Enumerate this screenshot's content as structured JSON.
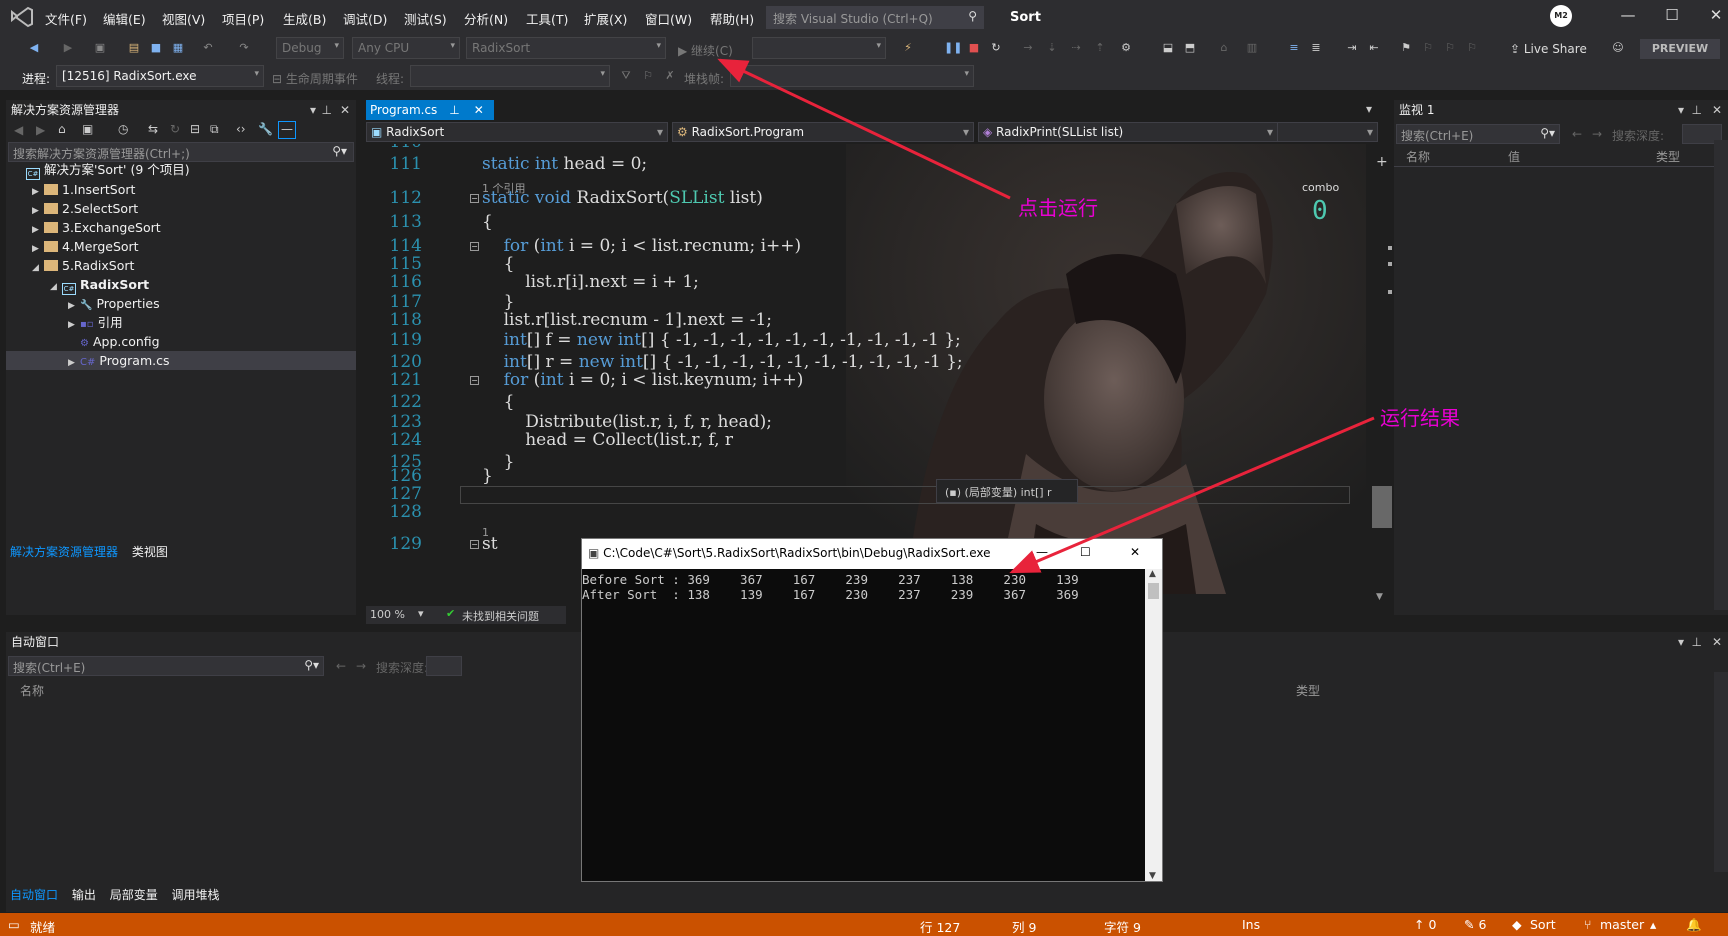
{
  "menu": {
    "items": [
      "文件(F)",
      "编辑(E)",
      "视图(V)",
      "项目(P)",
      "生成(B)",
      "调试(D)",
      "测试(S)",
      "分析(N)",
      "工具(T)",
      "扩展(X)",
      "窗口(W)",
      "帮助(H)"
    ],
    "search_placeholder": "搜索 Visual Studio (Ctrl+Q)",
    "solution_name": "Sort",
    "user_initials": "M2"
  },
  "toolbar": {
    "config": "Debug",
    "platform": "Any CPU",
    "startup_project": "RadixSort",
    "continue_label": "继续(C)",
    "live_share": "Live Share",
    "preview": "PREVIEW",
    "process_label": "进程:",
    "process_value": "[12516] RadixSort.exe",
    "lifecycle_label": "生命周期事件",
    "thread_label": "线程:",
    "stack_label": "堆栈帧:"
  },
  "solution_explorer": {
    "title": "解决方案资源管理器",
    "search_placeholder": "搜索解决方案资源管理器(Ctrl+;)",
    "items": [
      {
        "label": "解决方案'Sort' (9 个项目)",
        "indent": 0,
        "kind": "solution",
        "expand": ""
      },
      {
        "label": "1.InsertSort",
        "indent": 1,
        "kind": "folder",
        "expand": "▶"
      },
      {
        "label": "2.SelectSort",
        "indent": 1,
        "kind": "folder",
        "expand": "▶"
      },
      {
        "label": "3.ExchangeSort",
        "indent": 1,
        "kind": "folder",
        "expand": "▶"
      },
      {
        "label": "4.MergeSort",
        "indent": 1,
        "kind": "folder",
        "expand": "▶"
      },
      {
        "label": "5.RadixSort",
        "indent": 1,
        "kind": "folder",
        "expand": "◢"
      },
      {
        "label": "RadixSort",
        "indent": 2,
        "kind": "project",
        "expand": "◢"
      },
      {
        "label": "Properties",
        "indent": 3,
        "kind": "props",
        "expand": "▶"
      },
      {
        "label": "引用",
        "indent": 3,
        "kind": "refs",
        "expand": "▶"
      },
      {
        "label": "App.config",
        "indent": 3,
        "kind": "config",
        "expand": ""
      },
      {
        "label": "Program.cs",
        "indent": 3,
        "kind": "cs",
        "expand": "▶"
      }
    ],
    "tab_active": "解决方案资源管理器",
    "tab_other": "类视图"
  },
  "editor": {
    "tab_label": "Program.cs",
    "nav_project": "RadixSort",
    "nav_class": "RadixSort.Program",
    "nav_member": "RadixPrint(SLList list)",
    "zoom": "100 %",
    "issues": "未找到相关问题",
    "lines": [
      {
        "n": "110",
        "t": ""
      },
      {
        "n": "111",
        "t": "static int head = 0;"
      },
      {
        "n": "",
        "t": "1 个引用"
      },
      {
        "n": "112",
        "t": "static void RadixSort(SLList list)"
      },
      {
        "n": "113",
        "t": "{"
      },
      {
        "n": "114",
        "t": "    for (int i = 0; i < list.recnum; i++)"
      },
      {
        "n": "115",
        "t": "    {"
      },
      {
        "n": "116",
        "t": "        list.r[i].next = i + 1;"
      },
      {
        "n": "117",
        "t": "    }"
      },
      {
        "n": "118",
        "t": "    list.r[list.recnum - 1].next = -1;"
      },
      {
        "n": "119",
        "t": "    int[] f = new int[] { -1, -1, -1, -1, -1, -1, -1, -1, -1, -1 };"
      },
      {
        "n": "120",
        "t": "    int[] r = new int[] { -1, -1, -1, -1, -1, -1, -1, -1, -1, -1 };"
      },
      {
        "n": "121",
        "t": "    for (int i = 0; i < list.keynum; i++)"
      },
      {
        "n": "122",
        "t": "    {"
      },
      {
        "n": "123",
        "t": "        Distribute(list.r, i, f, r, head);"
      },
      {
        "n": "124",
        "t": "        head = Collect(list.r, f, r"
      },
      {
        "n": "125",
        "t": "    }"
      },
      {
        "n": "126",
        "t": "}"
      },
      {
        "n": "127",
        "t": ""
      },
      {
        "n": "128",
        "t": ""
      },
      {
        "n": "",
        "t": "1"
      },
      {
        "n": "129",
        "t": "st"
      }
    ],
    "combo_label": "combo",
    "combo_value": "0",
    "tooltip": "(局部变量) int[] r"
  },
  "watch": {
    "title": "监视 1",
    "search_placeholder": "搜索(Ctrl+E)",
    "depth_label": "搜索深度:",
    "cols": [
      "名称",
      "值",
      "类型"
    ]
  },
  "auto_window": {
    "title": "自动窗口",
    "search_placeholder": "搜索(Ctrl+E)",
    "depth_label": "搜索深度:",
    "col_name": "名称",
    "col_type": "类型",
    "tabs": [
      "自动窗口",
      "输出",
      "局部变量",
      "调用堆栈"
    ]
  },
  "console": {
    "title": "C:\\Code\\C#\\Sort\\5.RadixSort\\RadixSort\\bin\\Debug\\RadixSort.exe",
    "line1": "Before Sort : 369    367    167    239    237    138    230    139",
    "line2": "After Sort  : 138    139    167    230    237    239    367    369"
  },
  "annotations": {
    "click_run": "点击运行",
    "run_result": "运行结果",
    "color": "#e800d2"
  },
  "statusbar": {
    "ready": "就绪",
    "line": "行 127",
    "col": "列 9",
    "char": "字符 9",
    "ins": "Ins",
    "up": "↑ 0",
    "pencil": "✎ 6",
    "repo": "Sort",
    "branch": "master",
    "color": "#ca5100"
  }
}
